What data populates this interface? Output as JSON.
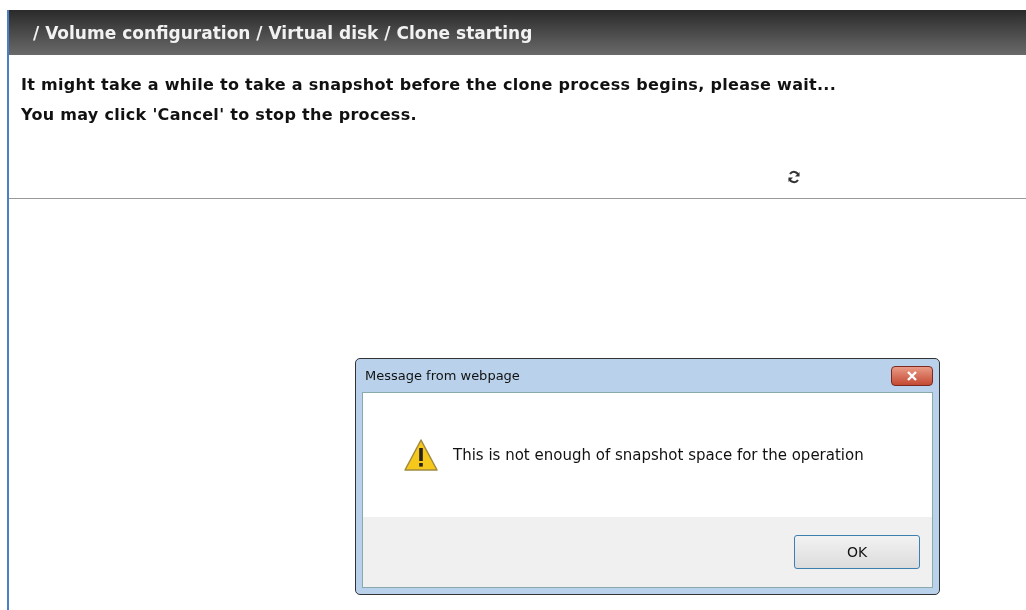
{
  "header": {
    "breadcrumb": "/ Volume configuration / Virtual disk / Clone starting"
  },
  "messages": [
    "It might take a while to take a snapshot before the clone process begins, please wait...",
    "You may click 'Cancel' to stop the process."
  ],
  "dialog": {
    "title": "Message from webpage",
    "message": "This is not enough of snapshot space for the operation",
    "buttons": [
      "OK"
    ]
  }
}
